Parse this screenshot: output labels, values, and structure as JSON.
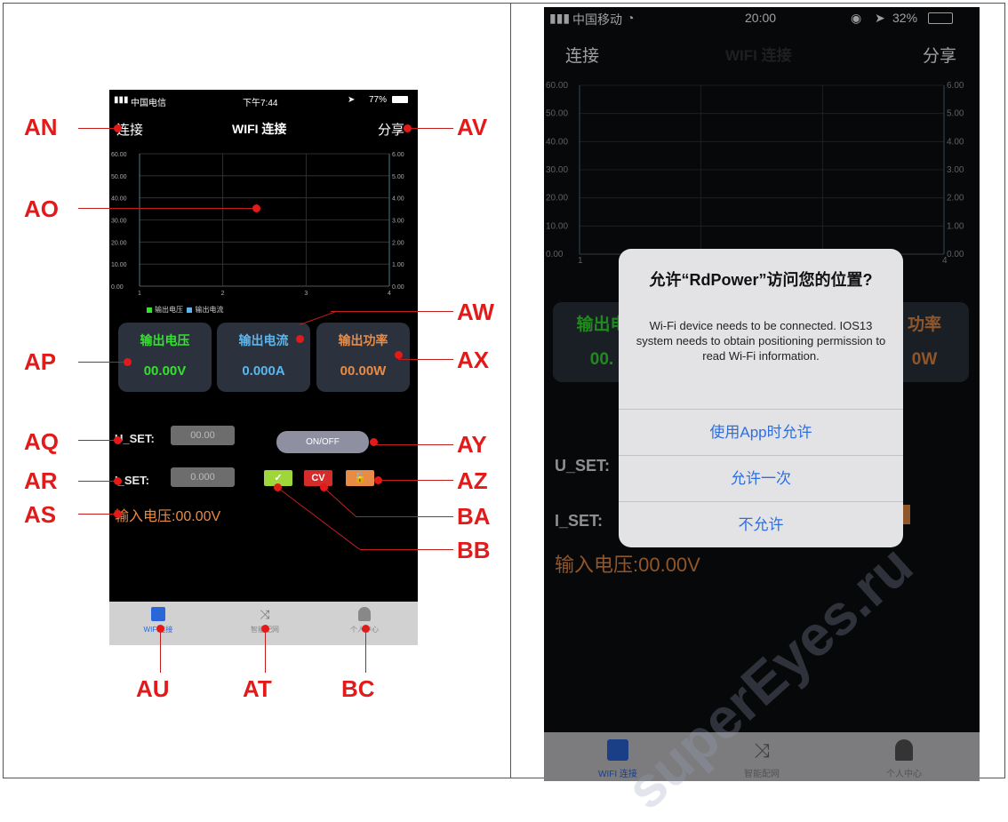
{
  "left_phone": {
    "status": {
      "carrier": "中国电信",
      "time": "下午7:44",
      "battery": "77%"
    },
    "nav": {
      "connect": "连接",
      "title": "WIFI 连接",
      "share": "分享"
    },
    "chart_left_ticks": [
      "60.00",
      "50.00",
      "40.00",
      "30.00",
      "20.00",
      "10.00",
      "0.00"
    ],
    "chart_right_ticks": [
      "6.00",
      "5.00",
      "4.00",
      "3.00",
      "2.00",
      "1.00",
      "0.00"
    ],
    "chart_x_ticks": [
      "1",
      "2",
      "3",
      "4"
    ],
    "legend": {
      "voltage": "输出电压",
      "current": "输出电流"
    },
    "cards": [
      {
        "label": "输出电压",
        "value": "00.00V",
        "label_color": "#35e02f",
        "value_color": "#35e02f"
      },
      {
        "label": "输出电流",
        "value": "0.000A",
        "label_color": "#5bb6ee",
        "value_color": "#5bb6ee"
      },
      {
        "label": "输出功率",
        "value": "00.00W",
        "label_color": "#e88b45",
        "value_color": "#e88b45"
      }
    ],
    "u_set": {
      "label": "U_SET:",
      "value": "00.00"
    },
    "i_set": {
      "label": "I_SET:",
      "value": "0.000"
    },
    "onoff": "ON/OFF",
    "cv_label": "CV",
    "input_voltage": "输入电压:00.00V",
    "tabs": [
      "WIFI连接",
      "智能配网",
      "个人中心"
    ]
  },
  "callouts": {
    "AN": "AN",
    "AO": "AO",
    "AP": "AP",
    "AQ": "AQ",
    "AR": "AR",
    "AS": "AS",
    "AV": "AV",
    "AW": "AW",
    "AX": "AX",
    "AY": "AY",
    "AZ": "AZ",
    "BA": "BA",
    "BB": "BB",
    "AU": "AU",
    "AT": "AT",
    "BC": "BC"
  },
  "right_phone": {
    "status": {
      "carrier": "中国移动",
      "time": "20:00",
      "battery": "32%"
    },
    "nav": {
      "connect": "连接",
      "title": "WIFI 连接",
      "share": "分享"
    },
    "chart_left_ticks": [
      "60.00",
      "50.00",
      "40.00",
      "30.00",
      "20.00",
      "10.00",
      "0.00"
    ],
    "chart_right_ticks": [
      "6.00",
      "5.00",
      "4.00",
      "3.00",
      "2.00",
      "1.00",
      "0.00"
    ],
    "chart_x_ticks": [
      "1",
      "4"
    ],
    "bg_card_left": "输出电",
    "bg_card_left_val": "00.",
    "bg_card_right": "功率",
    "bg_card_right_val": "0W",
    "u_set": "U_SET:",
    "i_set": "I_SET:",
    "input_voltage": "输入电压:00.00V",
    "alert": {
      "title": "允许“RdPower”访问您的位置?",
      "message": "Wi-Fi device needs to be connected. IOS13 system needs to obtain positioning permission to read Wi-Fi information.",
      "buttons": [
        "使用App时允许",
        "允许一次",
        "不允许"
      ]
    },
    "tabs": [
      "WIFI 连接",
      "智能配网",
      "个人中心"
    ]
  },
  "watermark": "superEyes.ru",
  "colors": {
    "voltage": "#35e02f",
    "current": "#5bb6ee",
    "power": "#e88b45",
    "callout": "#e21a1a",
    "alert_button": "#2d6fe0"
  }
}
